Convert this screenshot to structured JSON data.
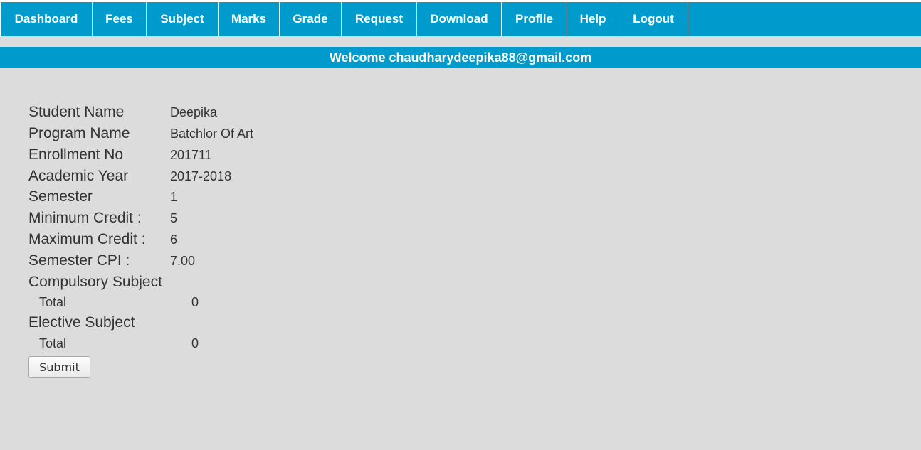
{
  "nav": {
    "items": [
      {
        "label": "Dashboard"
      },
      {
        "label": "Fees"
      },
      {
        "label": "Subject"
      },
      {
        "label": "Marks"
      },
      {
        "label": "Grade"
      },
      {
        "label": "Request"
      },
      {
        "label": "Download"
      },
      {
        "label": "Profile"
      },
      {
        "label": "Help"
      },
      {
        "label": "Logout"
      }
    ]
  },
  "welcome": "Welcome chaudharydeepika88@gmail.com",
  "student": {
    "name_label": "Student Name",
    "name_value": "Deepika",
    "program_label": "Program Name",
    "program_value": "Batchlor Of Art",
    "enrollment_label": "Enrollment No",
    "enrollment_value": "201711",
    "year_label": "Academic Year",
    "year_value": "2017-2018",
    "semester_label": "Semester",
    "semester_value": "1",
    "min_credit_label": "Minimum Credit :",
    "min_credit_value": "5",
    "max_credit_label": "Maximum Credit :",
    "max_credit_value": "6",
    "cpi_label": "Semester CPI :",
    "cpi_value": "7.00"
  },
  "compulsory": {
    "heading": "Compulsory Subject",
    "total_label": "Total",
    "total_value": "0"
  },
  "elective": {
    "heading": "Elective Subject",
    "total_label": "Total",
    "total_value": "0"
  },
  "submit_label": "Submit",
  "colors": {
    "accent": "#009bcd",
    "background": "#dcdcdc"
  }
}
